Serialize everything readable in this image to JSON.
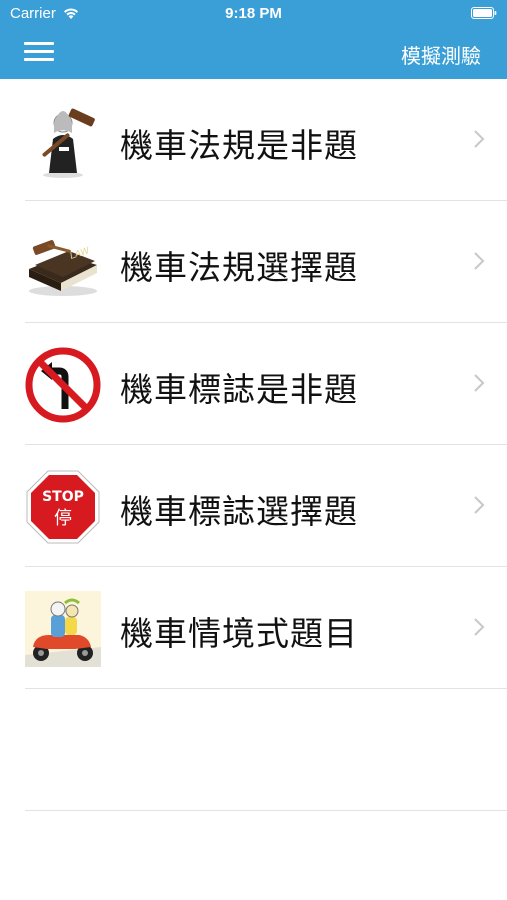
{
  "status_bar": {
    "carrier": "Carrier",
    "time": "9:18 PM"
  },
  "nav": {
    "mock_test_label": "模擬測驗",
    "bar_color": "#3a9fd6"
  },
  "menu_items": [
    {
      "label": "機車法規是非題",
      "icon": "judge-gavel-icon"
    },
    {
      "label": "機車法規選擇題",
      "icon": "law-book-gavel-icon"
    },
    {
      "label": "機車標誌是非題",
      "icon": "no-left-turn-sign-icon"
    },
    {
      "label": "機車標誌選擇題",
      "icon": "stop-sign-icon",
      "sign_text": [
        "STOP",
        "停"
      ]
    },
    {
      "label": "機車情境式題目",
      "icon": "scooter-riders-icon"
    }
  ]
}
